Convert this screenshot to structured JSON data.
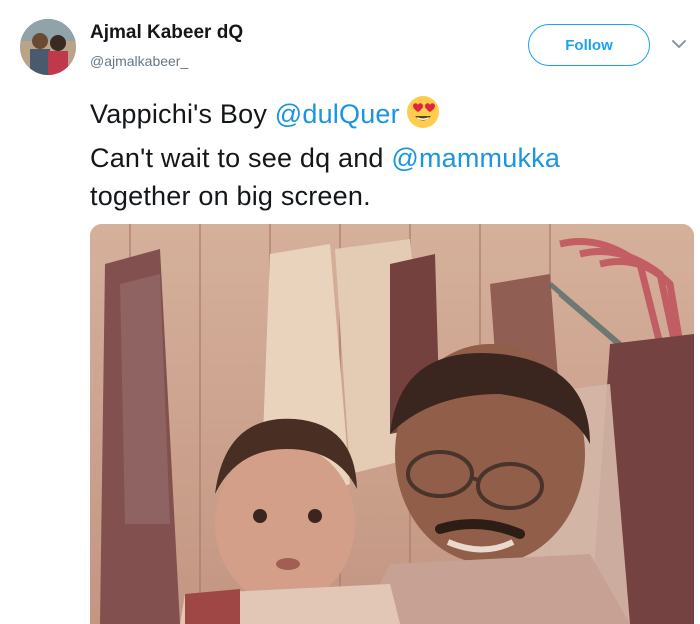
{
  "author": {
    "name": "Ajmal Kabeer dQ",
    "handle": "@ajmalkabeer_",
    "avatar_icon": "profile-photo"
  },
  "follow": {
    "label": "Follow"
  },
  "menu": {
    "icon": "chevron-down-icon"
  },
  "tweet": {
    "line1_text": "Vappichi's Boy ",
    "mention1": "@dulQuer",
    "emoji": "heart-eyes-emoji",
    "line2_text": "Can't wait to see dq and ",
    "mention2": "@mammukka",
    "line3_text": "together on big screen."
  },
  "media": {
    "type": "vintage photo of a man with glasses and a baby"
  },
  "colors": {
    "accent": "#1da1f2",
    "link": "#1b95e0",
    "text": "#14171a",
    "secondary": "#657786"
  }
}
